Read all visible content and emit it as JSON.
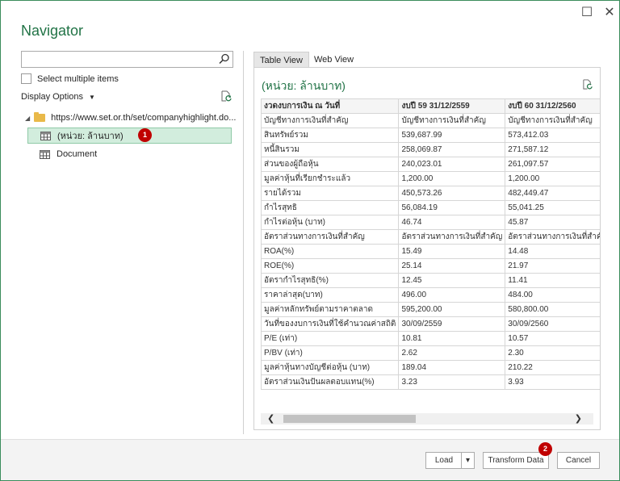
{
  "window": {
    "title": "Navigator",
    "minimize_glyph": "☐",
    "close_glyph": "✕"
  },
  "left": {
    "search": {
      "value": "",
      "placeholder": ""
    },
    "select_multiple_label": "Select multiple items",
    "display_options_label": "Display Options",
    "tree": {
      "root_label": "https://www.set.or.th/set/companyhighlight.do...",
      "items": [
        {
          "label": "(หน่วย: ล้านบาท)",
          "selected": true,
          "badge": "1"
        },
        {
          "label": "Document",
          "selected": false
        }
      ]
    }
  },
  "preview": {
    "tabs": [
      "Table View",
      "Web View"
    ],
    "active_tab": "Table View",
    "title": "(หน่วย: ล้านบาท)",
    "columns": [
      "งวดงบการเงิน ณ วันที่",
      "งบปี 59 31/12/2559",
      "งบปี 60 31/12/2560"
    ],
    "rows": [
      [
        "บัญชีทางการเงินที่สำคัญ",
        "บัญชีทางการเงินที่สำคัญ",
        "บัญชีทางการเงินที่สำคัญ"
      ],
      [
        "สินทรัพย์รวม",
        "539,687.99",
        "573,412.03"
      ],
      [
        "หนี้สินรวม",
        "258,069.87",
        "271,587.12"
      ],
      [
        "ส่วนของผู้ถือหุ้น",
        "240,023.01",
        "261,097.57"
      ],
      [
        "มูลค่าหุ้นที่เรียกชำระแล้ว",
        "1,200.00",
        "1,200.00"
      ],
      [
        "รายได้รวม",
        "450,573.26",
        "482,449.47"
      ],
      [
        "กำไรสุทธิ",
        "56,084.19",
        "55,041.25"
      ],
      [
        "กำไรต่อหุ้น (บาท)",
        "46.74",
        "45.87"
      ],
      [
        "อัตราส่วนทางการเงินที่สำคัญ",
        "อัตราส่วนทางการเงินที่สำคัญ",
        "อัตราส่วนทางการเงินที่สำคัญ"
      ],
      [
        "ROA(%)",
        "15.49",
        "14.48"
      ],
      [
        "ROE(%)",
        "25.14",
        "21.97"
      ],
      [
        "อัตรากำไรสุทธิ(%)",
        "12.45",
        "11.41"
      ],
      [
        "ราคาล่าสุด(บาท)",
        "496.00",
        "484.00"
      ],
      [
        "มูลค่าหลักทรัพย์ตามราคาตลาด",
        "595,200.00",
        "580,800.00"
      ],
      [
        "วันที่ของงบการเงินที่ใช้คำนวณค่าสถิติ",
        "30/09/2559",
        "30/09/2560"
      ],
      [
        "P/E (เท่า)",
        "10.81",
        "10.57"
      ],
      [
        "P/BV (เท่า)",
        "2.62",
        "2.30"
      ],
      [
        "มูลค่าหุ้นทางบัญชีต่อหุ้น (บาท)",
        "189.04",
        "210.22"
      ],
      [
        "อัตราส่วนเงินปันผลตอบแทน(%)",
        "3.23",
        "3.93"
      ]
    ],
    "scroll_left": "❮",
    "scroll_right": "❯"
  },
  "footer": {
    "load_label": "Load",
    "load_dropdown": "▾",
    "transform_label": "Transform Data",
    "transform_badge": "2",
    "cancel_label": "Cancel"
  },
  "colors": {
    "accent": "#217346",
    "selection": "#d2eddd",
    "badge": "#c00000",
    "border": "#3a8c5c"
  },
  "icons": [
    "search-icon",
    "refresh-icon",
    "folder-icon",
    "table-icon",
    "document-icon"
  ]
}
